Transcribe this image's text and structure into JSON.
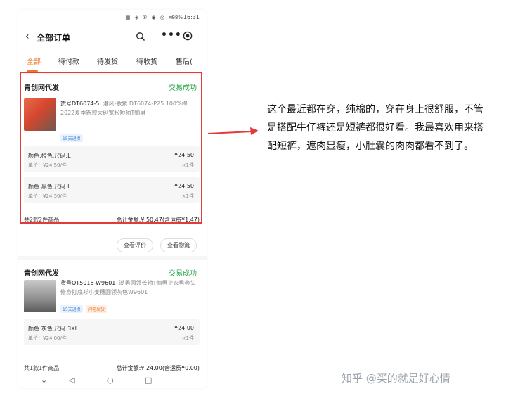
{
  "status_bar": {
    "battery": "98%",
    "time": "16:31"
  },
  "navbar": {
    "back_icon": "chevron-left-icon",
    "title": "全部订单"
  },
  "tabs": [
    {
      "label": "全部",
      "active": true
    },
    {
      "label": "待付款",
      "active": false
    },
    {
      "label": "待发货",
      "active": false
    },
    {
      "label": "待收货",
      "active": false
    },
    {
      "label": "售后(",
      "active": false
    }
  ],
  "orders": [
    {
      "shop": "青创网代发",
      "status": "交易成功",
      "item_code": "货号DT6074-5",
      "item_title": "港风-敏紫 DT6074-P25 100%棉2022夏季新款大码宽松短袖T恤男",
      "tags": [
        "15天退换"
      ],
      "skus": [
        {
          "spec": "颜色:橙色;尺码:L",
          "unit": "单价：¥24.50/件",
          "price": "¥24.50",
          "qty": "×1件"
        },
        {
          "spec": "颜色:黑色;尺码:L",
          "unit": "单价：¥24.50/件",
          "price": "¥24.50",
          "qty": "×1件"
        }
      ],
      "summary_left": "共2款2件商品",
      "summary_right": "总计金额:¥ 50.47(含运费¥1.47)",
      "buttons": [
        "查看评价",
        "查看物流"
      ]
    },
    {
      "shop": "青创网代发",
      "status": "交易成功",
      "item_code": "货号QT5015-W9601",
      "item_title": "潮男圆领长袖T恤男卫衣男套头修身打底衫小麦穗圆领灰色W9601",
      "tags": [
        "15天退换",
        "闪电发货"
      ],
      "skus": [
        {
          "spec": "颜色:灰色;尺码:3XL",
          "unit": "单价：¥24.00/件",
          "price": "¥24.00",
          "qty": "×1件"
        }
      ],
      "summary_left": "共1款1件商品",
      "summary_right": "总计金额:¥ 24.00(含运费¥0.00)"
    }
  ],
  "review_text": "这个最近都在穿，纯棉的，穿在身上很舒服，不管是搭配牛仔裤还是短裤都很好看。我最喜欢用来搭配短裤，遮肉显瘦，小肚囊的肉肉都看不到了。",
  "watermark": "知乎 @买的就是好心情",
  "colors": {
    "accent": "#f0752a",
    "success": "#2aa34a",
    "highlight": "#e33a3a"
  }
}
